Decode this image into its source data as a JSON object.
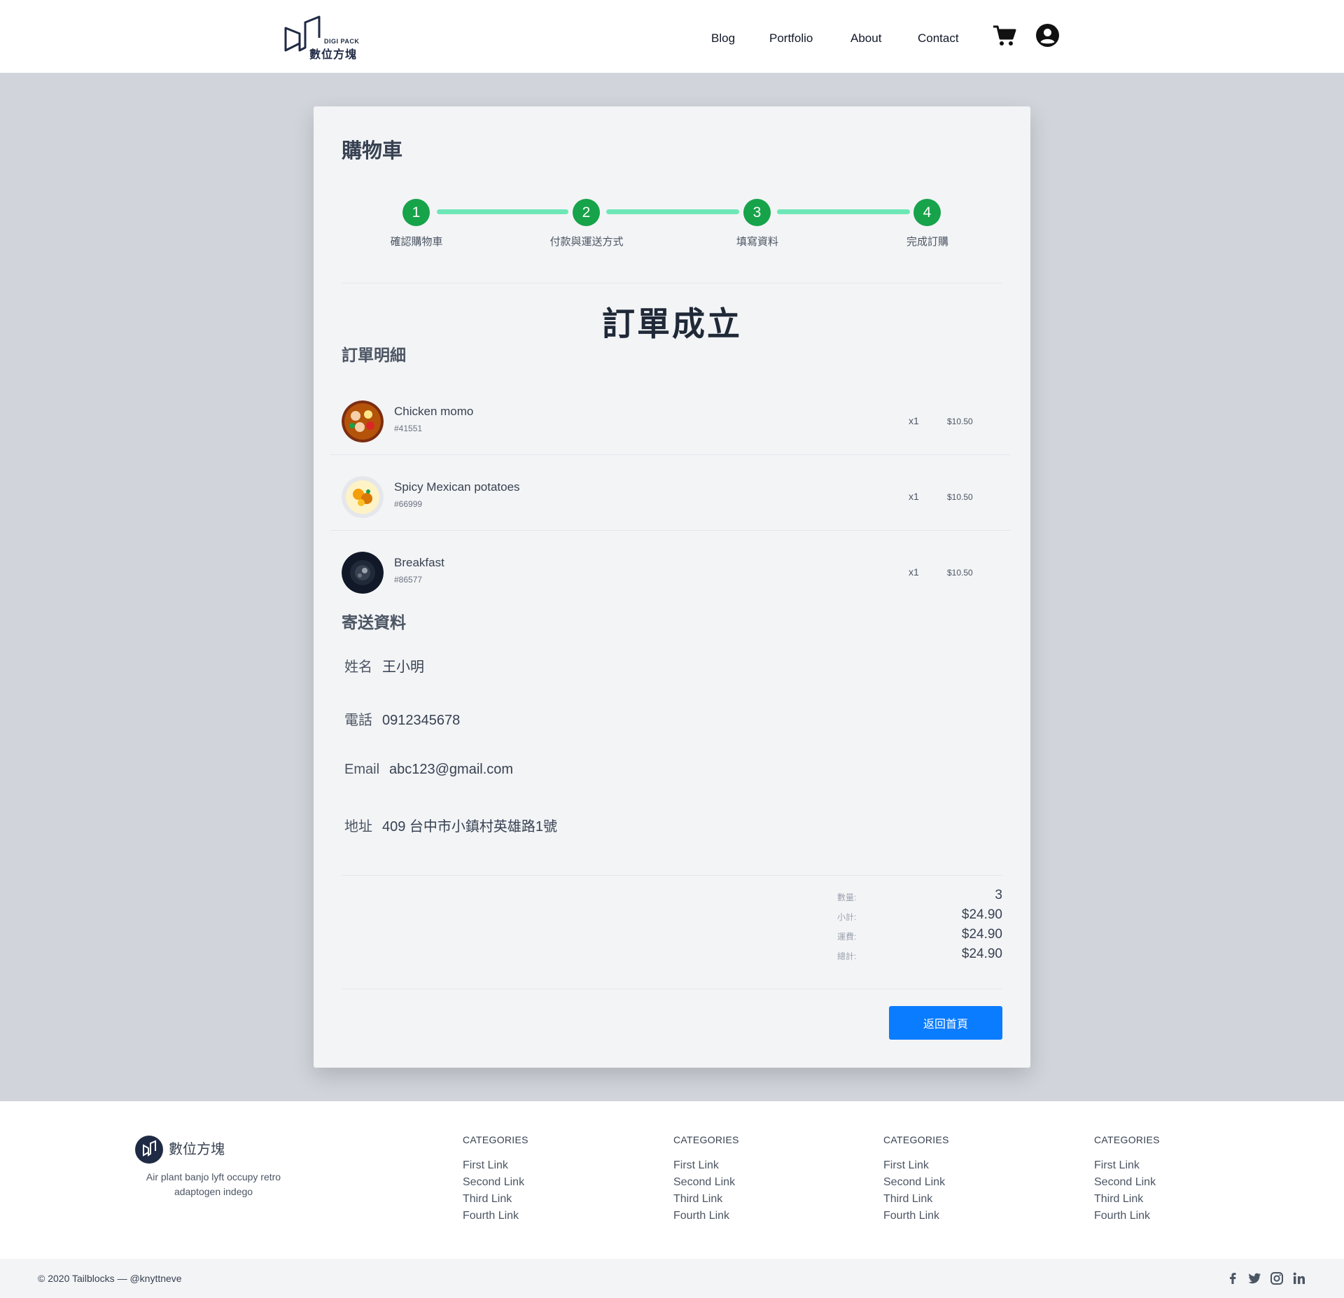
{
  "brand": {
    "name_en": "DIGI PACK",
    "name_zh": "數位方塊"
  },
  "nav": {
    "items": [
      "Blog",
      "Portfolio",
      "About",
      "Contact"
    ]
  },
  "icons": {
    "cart": "shopping-cart-icon",
    "user": "user-circle-icon"
  },
  "card": {
    "title": "購物車",
    "steps": [
      {
        "number": "1",
        "label": "確認購物車"
      },
      {
        "number": "2",
        "label": "付款與運送方式"
      },
      {
        "number": "3",
        "label": "填寫資料"
      },
      {
        "number": "4",
        "label": "完成訂購"
      }
    ],
    "order_heading": "訂單成立",
    "details_title": "訂單明細",
    "items": [
      {
        "name": "Chicken momo",
        "code": "#41551",
        "qty": "x1",
        "price": "$10.50"
      },
      {
        "name": "Spicy Mexican potatoes",
        "code": "#66999",
        "qty": "x1",
        "price": "$10.50"
      },
      {
        "name": "Breakfast",
        "code": "#86577",
        "qty": "x1",
        "price": "$10.50"
      }
    ],
    "shipping_title": "寄送資料",
    "shipping": {
      "name_label": "姓名",
      "name": "王小明",
      "phone_label": "電話",
      "phone": "0912345678",
      "email_label": "Email",
      "email": "abc123@gmail.com",
      "address_label": "地址",
      "address": "409 台中市小鎮村英雄路1號"
    },
    "summary": [
      {
        "label": "數量:",
        "value": "3"
      },
      {
        "label": "小計:",
        "value": "$24.90"
      },
      {
        "label": "運費:",
        "value": "$24.90"
      },
      {
        "label": "總計:",
        "value": "$24.90"
      }
    ],
    "home_button": "返回首頁"
  },
  "colors": {
    "step_active": "#16a34a",
    "step_line": "#6ee7b7",
    "button": "#0a7cff",
    "page_bg": "#d1d5db"
  },
  "footer": {
    "brand": "數位方塊",
    "description": "Air plant banjo lyft occupy retro adaptogen indego",
    "columns": [
      {
        "title": "CATEGORIES",
        "links": [
          "First Link",
          "Second Link",
          "Third Link",
          "Fourth Link"
        ]
      },
      {
        "title": "CATEGORIES",
        "links": [
          "First Link",
          "Second Link",
          "Third Link",
          "Fourth Link"
        ]
      },
      {
        "title": "CATEGORIES",
        "links": [
          "First Link",
          "Second Link",
          "Third Link",
          "Fourth Link"
        ]
      },
      {
        "title": "CATEGORIES",
        "links": [
          "First Link",
          "Second Link",
          "Third Link",
          "Fourth Link"
        ]
      }
    ],
    "copyright": "© 2020 Tailblocks — @knyttneve",
    "social": [
      "facebook-icon",
      "twitter-icon",
      "instagram-icon",
      "linkedin-icon"
    ]
  }
}
